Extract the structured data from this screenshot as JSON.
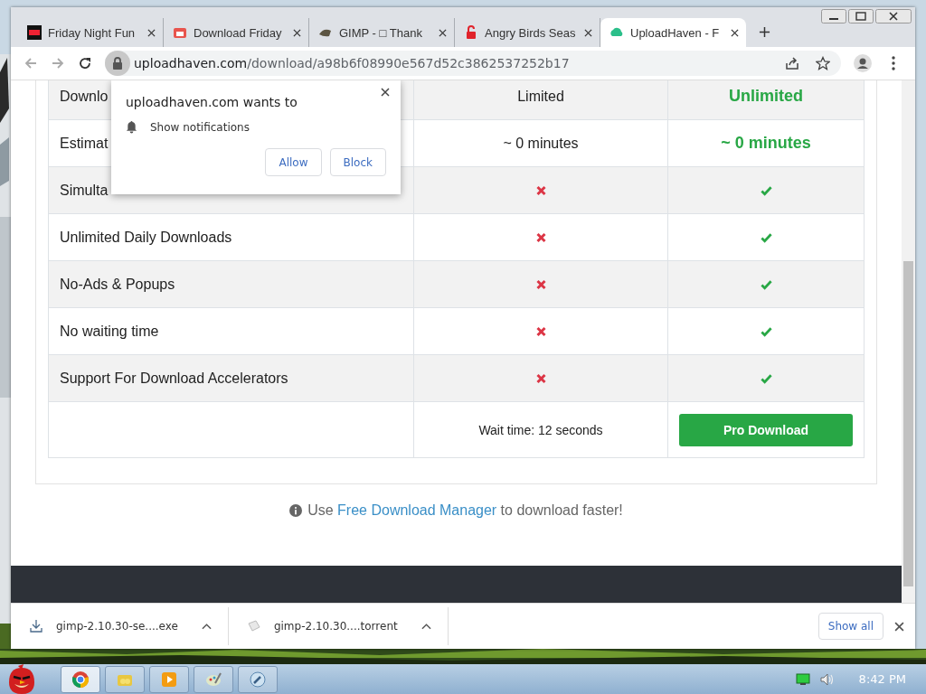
{
  "tabs": [
    {
      "title": "Friday Night Fun",
      "selected": false
    },
    {
      "title": "Download Friday",
      "selected": false
    },
    {
      "title": "GIMP - □ Thank",
      "selected": false
    },
    {
      "title": "Angry Birds Seas",
      "selected": false
    },
    {
      "title": "UploadHaven - F",
      "selected": true
    }
  ],
  "address": {
    "host": "uploadhaven.com",
    "path": "/download/a98b6f08990e567d52c3862537252b17"
  },
  "table": {
    "rows": [
      {
        "label": "Downlo",
        "cells": [
          {
            "kind": "text",
            "text": "Limited"
          },
          {
            "kind": "strong",
            "text": "Unlimited"
          }
        ]
      },
      {
        "label": "Estimat",
        "cells": [
          {
            "kind": "text",
            "text": "~ 0 minutes"
          },
          {
            "kind": "strong",
            "text": "~ 0 minutes"
          }
        ]
      },
      {
        "label": "Simulta",
        "cells": [
          {
            "kind": "cross"
          },
          {
            "kind": "check"
          }
        ]
      },
      {
        "label": "Unlimited Daily Downloads",
        "cells": [
          {
            "kind": "cross"
          },
          {
            "kind": "check"
          }
        ]
      },
      {
        "label": "No-Ads & Popups",
        "cells": [
          {
            "kind": "cross"
          },
          {
            "kind": "check"
          }
        ]
      },
      {
        "label": "No waiting time",
        "cells": [
          {
            "kind": "cross"
          },
          {
            "kind": "check"
          }
        ]
      },
      {
        "label": "Support For Download Accelerators",
        "cells": [
          {
            "kind": "cross"
          },
          {
            "kind": "check"
          }
        ]
      }
    ],
    "wait": "Wait time: 12 seconds",
    "button": "Pro Download"
  },
  "info": {
    "before": "Use",
    "link": "Free Download Manager",
    "after": "to download faster!"
  },
  "popup": {
    "title": "uploadhaven.com wants to",
    "permission": "Show notifications",
    "buttons": [
      "Allow",
      "Block"
    ]
  },
  "downloads": {
    "items": [
      {
        "name": "gimp-2.10.30-se....exe",
        "kind": "exe"
      },
      {
        "name": "gimp-2.10.30....torrent",
        "kind": "torrent"
      }
    ],
    "show_all": "Show all"
  },
  "taskbar": {
    "apps": [
      {
        "kind": "chrome",
        "selected": true
      },
      {
        "kind": "folder",
        "selected": false
      },
      {
        "kind": "media",
        "selected": false
      },
      {
        "kind": "paint",
        "selected": false
      },
      {
        "kind": "tool",
        "selected": false
      }
    ],
    "time": "8:42 PM"
  }
}
